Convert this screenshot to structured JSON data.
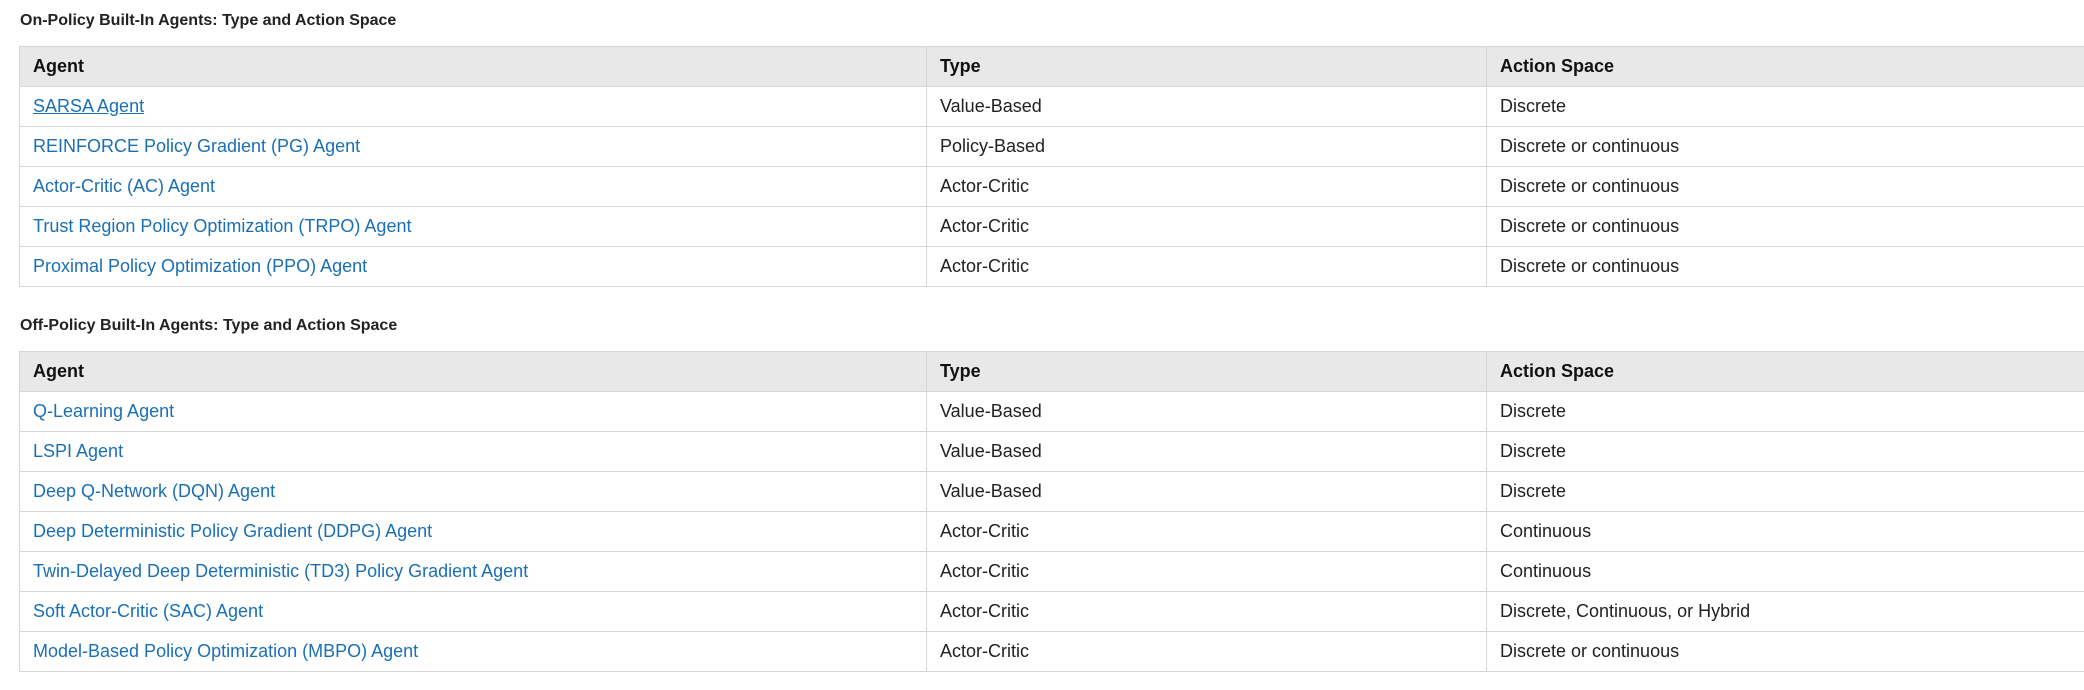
{
  "on_policy": {
    "caption": "On-Policy Built-In Agents: Type and Action Space",
    "headers": [
      "Agent",
      "Type",
      "Action Space"
    ],
    "rows": [
      {
        "agent": "SARSA Agent",
        "type": "Value-Based",
        "action_space": "Discrete"
      },
      {
        "agent": "REINFORCE Policy Gradient (PG) Agent",
        "type": "Policy-Based",
        "action_space": "Discrete or continuous"
      },
      {
        "agent": "Actor-Critic (AC) Agent",
        "type": "Actor-Critic",
        "action_space": "Discrete or continuous"
      },
      {
        "agent": "Trust Region Policy Optimization (TRPO) Agent",
        "type": "Actor-Critic",
        "action_space": "Discrete or continuous"
      },
      {
        "agent": "Proximal Policy Optimization (PPO) Agent",
        "type": "Actor-Critic",
        "action_space": "Discrete or continuous"
      }
    ]
  },
  "off_policy": {
    "caption": "Off-Policy Built-In Agents: Type and Action Space",
    "headers": [
      "Agent",
      "Type",
      "Action Space"
    ],
    "rows": [
      {
        "agent": "Q-Learning Agent",
        "type": "Value-Based",
        "action_space": "Discrete"
      },
      {
        "agent": "LSPI Agent",
        "type": "Value-Based",
        "action_space": "Discrete"
      },
      {
        "agent": "Deep Q-Network (DQN) Agent",
        "type": "Value-Based",
        "action_space": "Discrete"
      },
      {
        "agent": "Deep Deterministic Policy Gradient (DDPG) Agent",
        "type": "Actor-Critic",
        "action_space": "Continuous"
      },
      {
        "agent": "Twin-Delayed Deep Deterministic (TD3) Policy Gradient Agent",
        "type": "Actor-Critic",
        "action_space": "Continuous"
      },
      {
        "agent": "Soft Actor-Critic (SAC) Agent",
        "type": "Actor-Critic",
        "action_space": "Discrete, Continuous, or Hybrid"
      },
      {
        "agent": "Model-Based Policy Optimization (MBPO) Agent",
        "type": "Actor-Critic",
        "action_space": "Discrete or continuous"
      }
    ]
  },
  "colors": {
    "link": "#1a6fb5",
    "header_bg": "#e8e8e8",
    "border": "#d6d6d6"
  }
}
